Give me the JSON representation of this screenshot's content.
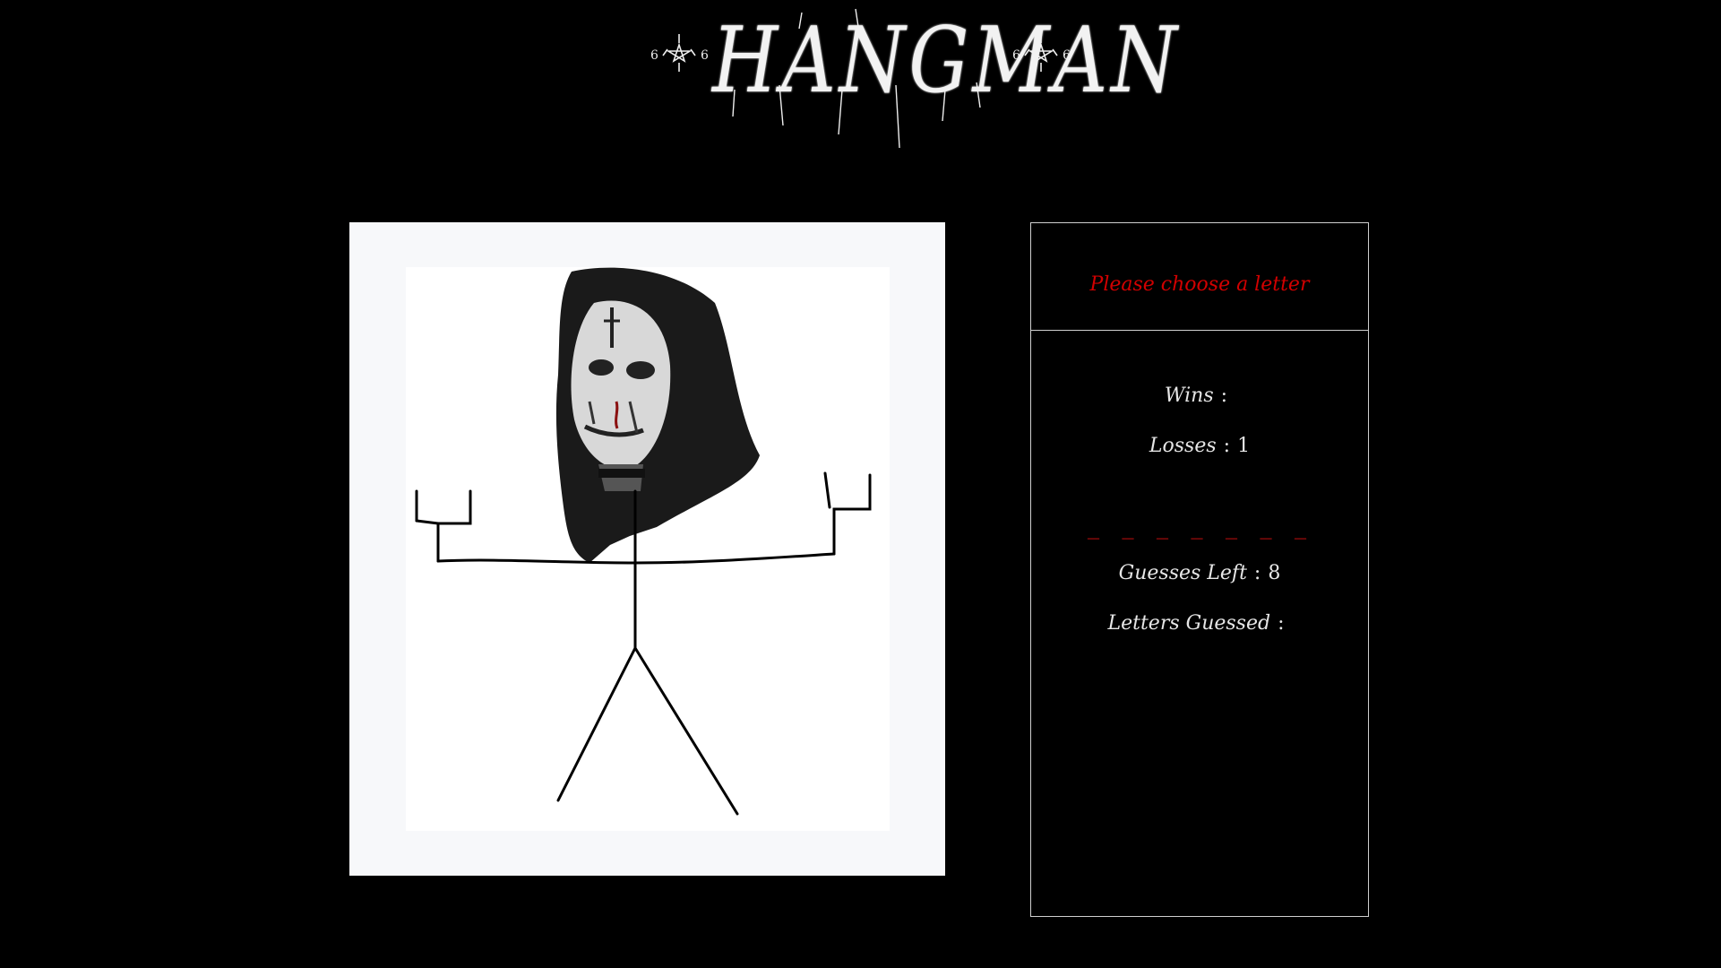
{
  "header": {
    "title": "HANGMAN",
    "emblem_left": "pentagram-emblem",
    "emblem_right": "pentagram-emblem"
  },
  "drawing": {
    "figure": "stick-figure-with-head-photo",
    "head_image": "corpse-paint-head-photo"
  },
  "prompt": {
    "text": "Please choose a letter"
  },
  "stats": {
    "wins_label": "Wins",
    "wins_value": "",
    "losses_label": "Losses",
    "losses_value": "1",
    "separator": ":"
  },
  "word": {
    "blanks": "_ _ _ _ _ _ _"
  },
  "guesses": {
    "left_label": "Guesses Left",
    "left_value": "8",
    "letters_label": "Letters Guessed",
    "letters_value": ""
  },
  "colors": {
    "background": "#000000",
    "prompt": "#d10000",
    "blanks": "#e01010",
    "text": "#e6e6e6",
    "panel_border": "#cfcfcf"
  }
}
